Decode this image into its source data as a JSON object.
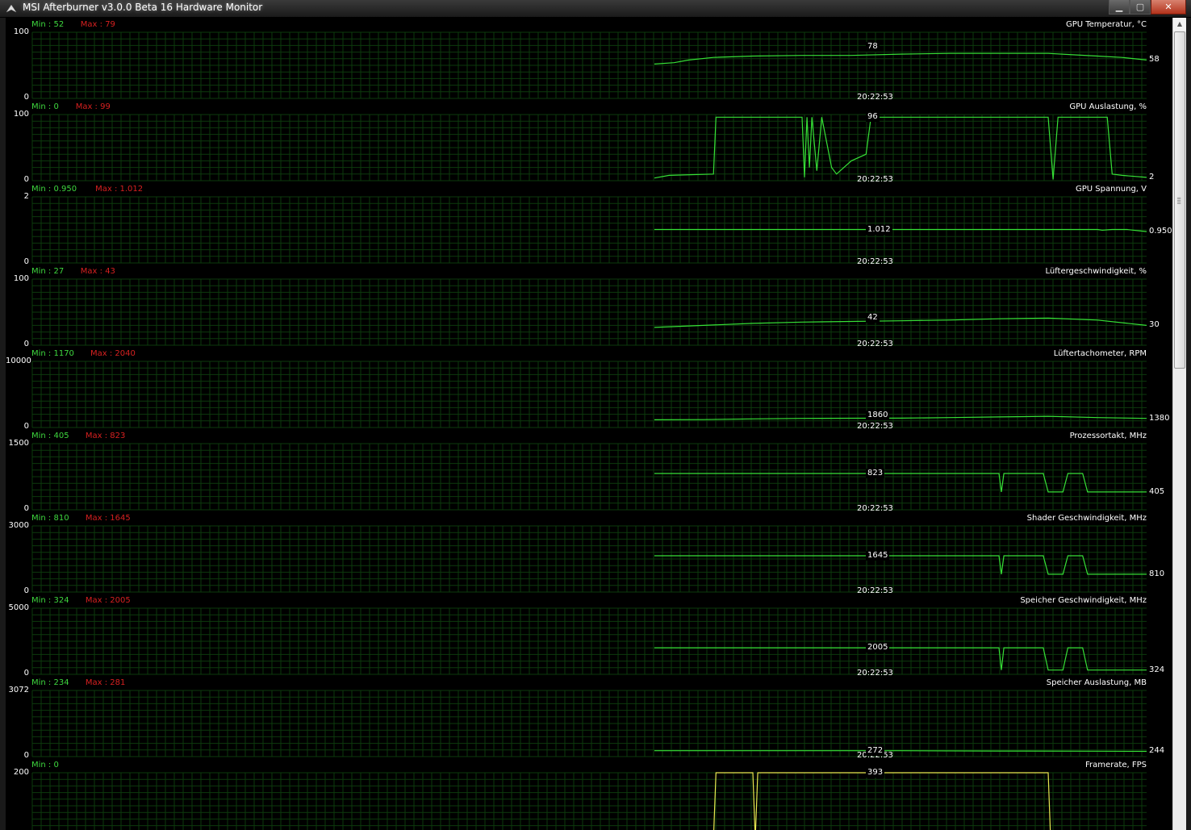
{
  "window": {
    "title": "MSI Afterburner v3.0.0 Beta 16 Hardware Monitor",
    "minimize_icon": "minimize-icon",
    "maximize_icon": "maximize-icon",
    "close_icon": "close-icon"
  },
  "colors": {
    "graph_line": "#36e036",
    "framerate_line": "#e8e850",
    "grid": "#0d3a0d",
    "min_text": "#3ed63e",
    "max_text": "#d62020"
  },
  "graphs": [
    {
      "title": "GPU Temperatur, °C",
      "min_label": "Min : 52",
      "max_label": "Max : 79",
      "ymax": "100",
      "ymin": "0",
      "time": "20:22:53",
      "marker_value": "78",
      "current_value": "58"
    },
    {
      "title": "GPU Auslastung, %",
      "min_label": "Min : 0",
      "max_label": "Max : 99",
      "ymax": "100",
      "ymin": "0",
      "time": "20:22:53",
      "marker_value": "96",
      "current_value": "2"
    },
    {
      "title": "GPU Spannung, V",
      "min_label": "Min : 0.950",
      "max_label": "Max : 1.012",
      "ymax": "2",
      "ymin": "0",
      "time": "20:22:53",
      "marker_value": "1.012",
      "current_value": "0.950"
    },
    {
      "title": "Lüftergeschwindigkeit, %",
      "min_label": "Min : 27",
      "max_label": "Max : 43",
      "ymax": "100",
      "ymin": "0",
      "time": "20:22:53",
      "marker_value": "42",
      "current_value": "30"
    },
    {
      "title": "Lüftertachometer, RPM",
      "min_label": "Min : 1170",
      "max_label": "Max : 2040",
      "ymax": "10000",
      "ymin": "0",
      "time": "20:22:53",
      "marker_value": "1860",
      "current_value": "1380"
    },
    {
      "title": "Prozessortakt, MHz",
      "min_label": "Min : 405",
      "max_label": "Max : 823",
      "ymax": "1500",
      "ymin": "0",
      "time": "20:22:53",
      "marker_value": "823",
      "current_value": "405"
    },
    {
      "title": "Shader Geschwindigkeit, MHz",
      "min_label": "Min : 810",
      "max_label": "Max : 1645",
      "ymax": "3000",
      "ymin": "0",
      "time": "20:22:53",
      "marker_value": "1645",
      "current_value": "810"
    },
    {
      "title": "Speicher Geschwindigkeit, MHz",
      "min_label": "Min : 324",
      "max_label": "Max : 2005",
      "ymax": "5000",
      "ymin": "0",
      "time": "20:22:53",
      "marker_value": "2005",
      "current_value": "324"
    },
    {
      "title": "Speicher Auslastung, MB",
      "min_label": "Min : 234",
      "max_label": "Max : 281",
      "ymax": "3072",
      "ymin": "0",
      "time": "20:22:53",
      "marker_value": "272",
      "current_value": "244"
    },
    {
      "title": "Framerate, FPS",
      "min_label": "Min : 0",
      "max_label": "",
      "ymax": "200",
      "ymin": "",
      "time": "",
      "marker_value": "393",
      "current_value": ""
    }
  ],
  "series": [
    [
      [
        0,
        52
      ],
      [
        0.04,
        54
      ],
      [
        0.07,
        58
      ],
      [
        0.12,
        62
      ],
      [
        0.2,
        64
      ],
      [
        0.3,
        65
      ],
      [
        0.4,
        65
      ],
      [
        0.5,
        67
      ],
      [
        0.6,
        68
      ],
      [
        0.7,
        68
      ],
      [
        0.8,
        68
      ],
      [
        0.85,
        66
      ],
      [
        0.9,
        64
      ],
      [
        0.95,
        62
      ],
      [
        1.0,
        58
      ]
    ],
    [
      [
        0,
        4
      ],
      [
        0.03,
        8
      ],
      [
        0.12,
        10
      ],
      [
        0.125,
        96
      ],
      [
        0.2,
        96
      ],
      [
        0.3,
        96
      ],
      [
        0.305,
        5
      ],
      [
        0.31,
        96
      ],
      [
        0.315,
        20
      ],
      [
        0.32,
        96
      ],
      [
        0.33,
        15
      ],
      [
        0.34,
        96
      ],
      [
        0.36,
        20
      ],
      [
        0.37,
        10
      ],
      [
        0.4,
        30
      ],
      [
        0.43,
        40
      ],
      [
        0.44,
        96
      ],
      [
        0.6,
        96
      ],
      [
        0.8,
        96
      ],
      [
        0.81,
        2
      ],
      [
        0.82,
        96
      ],
      [
        0.9,
        96
      ],
      [
        0.92,
        96
      ],
      [
        0.93,
        10
      ],
      [
        0.95,
        8
      ],
      [
        1.0,
        5
      ]
    ],
    [
      [
        0,
        1.012
      ],
      [
        0.2,
        1.012
      ],
      [
        0.4,
        1.012
      ],
      [
        0.6,
        1.012
      ],
      [
        0.8,
        1.012
      ],
      [
        0.9,
        1.012
      ],
      [
        0.91,
        0.99
      ],
      [
        0.93,
        1.012
      ],
      [
        0.96,
        1.012
      ],
      [
        1.0,
        0.95
      ]
    ],
    [
      [
        0,
        27
      ],
      [
        0.1,
        30
      ],
      [
        0.2,
        33
      ],
      [
        0.3,
        35
      ],
      [
        0.4,
        36
      ],
      [
        0.5,
        37
      ],
      [
        0.6,
        38
      ],
      [
        0.7,
        40
      ],
      [
        0.8,
        41
      ],
      [
        0.9,
        38
      ],
      [
        1.0,
        30
      ]
    ],
    [
      [
        0,
        1170
      ],
      [
        0.1,
        1200
      ],
      [
        0.2,
        1300
      ],
      [
        0.3,
        1380
      ],
      [
        0.4,
        1400
      ],
      [
        0.5,
        1420
      ],
      [
        0.6,
        1500
      ],
      [
        0.7,
        1600
      ],
      [
        0.8,
        1700
      ],
      [
        0.9,
        1500
      ],
      [
        1.0,
        1380
      ]
    ],
    [
      [
        0,
        823
      ],
      [
        0.7,
        823
      ],
      [
        0.705,
        405
      ],
      [
        0.71,
        823
      ],
      [
        0.79,
        823
      ],
      [
        0.8,
        405
      ],
      [
        0.83,
        405
      ],
      [
        0.84,
        823
      ],
      [
        0.87,
        823
      ],
      [
        0.88,
        405
      ],
      [
        1.0,
        405
      ]
    ],
    [
      [
        0,
        1645
      ],
      [
        0.7,
        1645
      ],
      [
        0.705,
        810
      ],
      [
        0.71,
        1645
      ],
      [
        0.79,
        1645
      ],
      [
        0.8,
        810
      ],
      [
        0.83,
        810
      ],
      [
        0.84,
        1645
      ],
      [
        0.87,
        1645
      ],
      [
        0.88,
        810
      ],
      [
        1.0,
        810
      ]
    ],
    [
      [
        0,
        2005
      ],
      [
        0.7,
        2005
      ],
      [
        0.705,
        324
      ],
      [
        0.71,
        2005
      ],
      [
        0.79,
        2005
      ],
      [
        0.8,
        324
      ],
      [
        0.83,
        324
      ],
      [
        0.84,
        2005
      ],
      [
        0.87,
        2005
      ],
      [
        0.88,
        324
      ],
      [
        1.0,
        324
      ]
    ],
    [
      [
        0,
        272
      ],
      [
        0.5,
        272
      ],
      [
        0.7,
        260
      ],
      [
        0.9,
        250
      ],
      [
        1.0,
        244
      ]
    ],
    [
      [
        0,
        0
      ],
      [
        0.12,
        0
      ],
      [
        0.125,
        393
      ],
      [
        0.2,
        393
      ],
      [
        0.205,
        0
      ],
      [
        0.21,
        393
      ],
      [
        0.8,
        393
      ],
      [
        0.805,
        0
      ],
      [
        0.85,
        0
      ],
      [
        0.855,
        0
      ],
      [
        0.95,
        0
      ]
    ]
  ]
}
